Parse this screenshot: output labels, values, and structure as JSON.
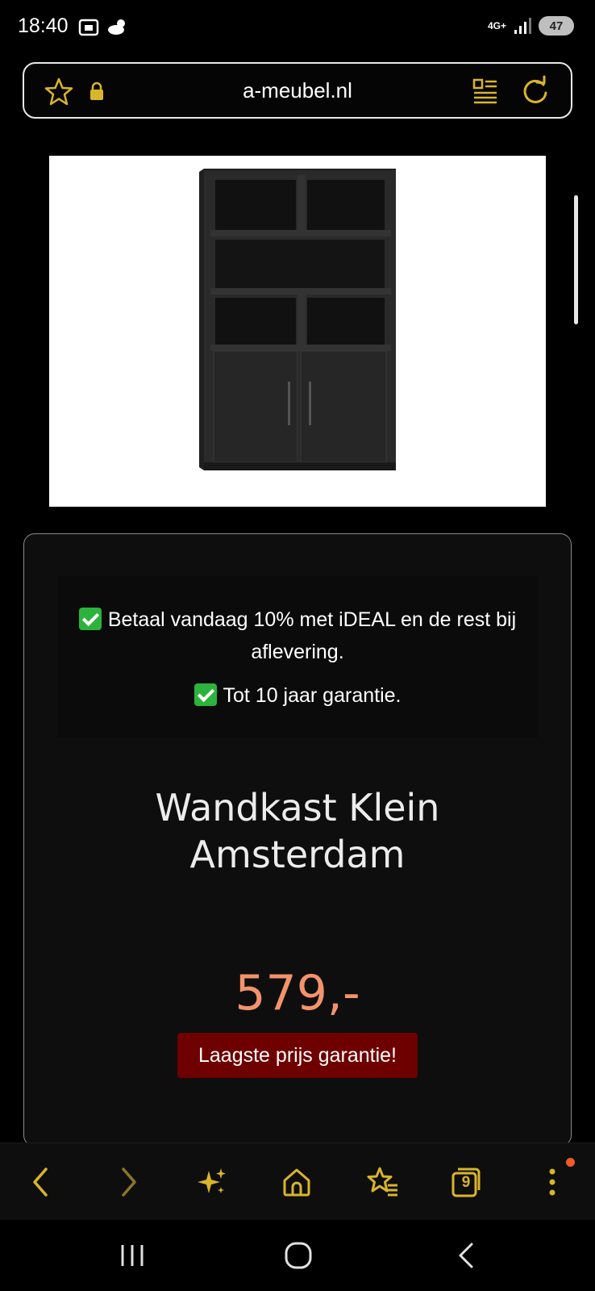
{
  "status_bar": {
    "time": "18:40",
    "network": "4G+",
    "battery": "47"
  },
  "browser": {
    "url": "a-meubel.nl",
    "accent_color": "#d9b52a"
  },
  "product": {
    "usp_lines": [
      "Betaal vandaag 10% met iDEAL en de rest bij aflevering.",
      "Tot 10 jaar garantie."
    ],
    "title": "Wandkast Klein Amsterdam",
    "price": "579,-",
    "guarantee_badge": "Laagste prijs garantie!",
    "price_color": "#f3936b",
    "badge_color": "#6e0000"
  },
  "browser_toolbar": {
    "tabs_count": "9",
    "icons": [
      "back-icon",
      "forward-icon",
      "sparkle-icon",
      "home-icon",
      "bookmarks-icon",
      "tabs-icon",
      "menu-icon"
    ]
  },
  "system_nav": {
    "icons": [
      "recents-icon",
      "home-icon",
      "back-icon"
    ]
  }
}
